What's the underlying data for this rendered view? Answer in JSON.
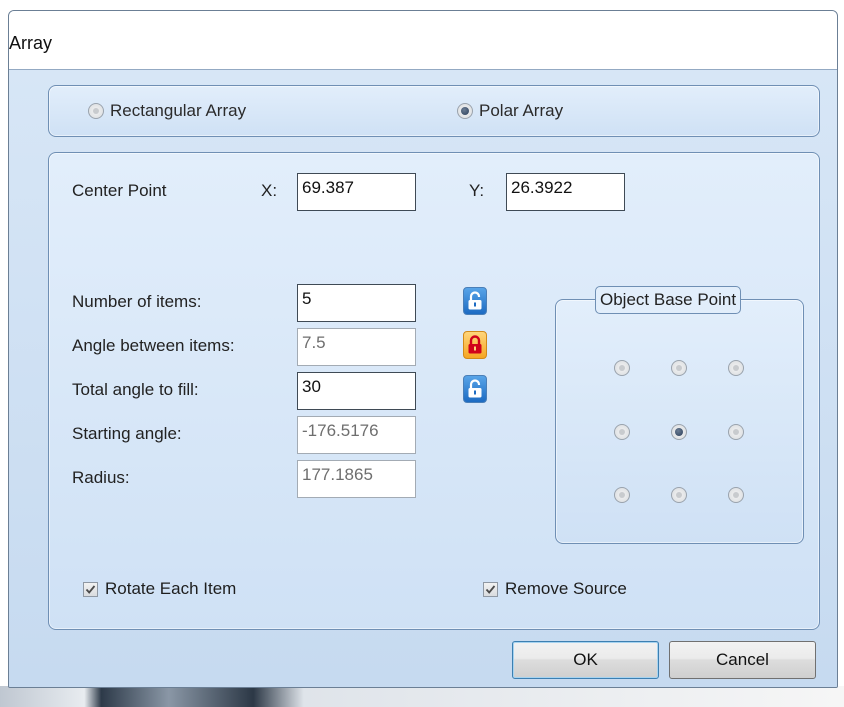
{
  "window": {
    "title": "Array"
  },
  "array_type": {
    "rectangular": {
      "label": "Rectangular Array",
      "selected": false
    },
    "polar": {
      "label": "Polar Array",
      "selected": true
    }
  },
  "center_point": {
    "label": "Center Point",
    "x_label": "X:",
    "x_value": "69.387",
    "y_label": "Y:",
    "y_value": "26.3922"
  },
  "fields": {
    "number_of_items": {
      "label": "Number of items:",
      "value": "5",
      "lock": "unlocked"
    },
    "angle_between_items": {
      "label": "Angle between items:",
      "value": "7.5",
      "lock": "locked"
    },
    "total_angle": {
      "label": "Total angle to fill:",
      "value": "30",
      "lock": "unlocked"
    },
    "starting_angle": {
      "label": "Starting angle:",
      "value": "-176.5176"
    },
    "radius": {
      "label": "Radius:",
      "value": "177.1865"
    }
  },
  "object_base_point": {
    "title": "Object Base Point",
    "selected": "center"
  },
  "options": {
    "rotate_each_item": {
      "label": "Rotate Each Item",
      "checked": true
    },
    "remove_source": {
      "label": "Remove Source",
      "checked": true
    }
  },
  "buttons": {
    "ok": "OK",
    "cancel": "Cancel"
  },
  "colors": {
    "lock_unlocked": "#1d6bc2",
    "lock_locked": "#f5a623",
    "lock_shackle_locked": "#d0021b"
  }
}
